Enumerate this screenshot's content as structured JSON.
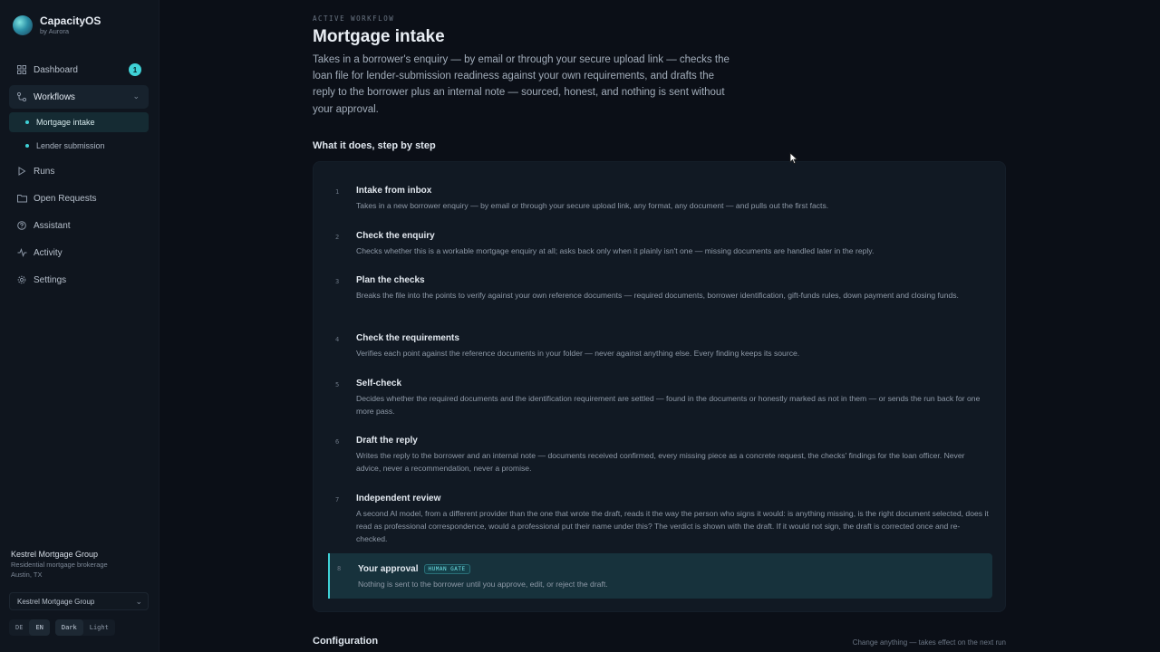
{
  "brand": {
    "name": "CapacityOS",
    "sub": "by Aurora"
  },
  "nav": {
    "dashboard": {
      "label": "Dashboard",
      "badge": "1"
    },
    "workflows": {
      "label": "Workflows"
    },
    "workflow_items": [
      "Mortgage intake",
      "Lender submission"
    ],
    "runs": "Runs",
    "open_requests": "Open Requests",
    "assistant": "Assistant",
    "activity": "Activity",
    "settings": "Settings"
  },
  "org": {
    "name": "Kestrel Mortgage Group",
    "type": "Residential mortgage brokerage",
    "location": "Austin, TX",
    "select_value": "Kestrel Mortgage Group"
  },
  "toggles": {
    "lang_de": "DE",
    "lang_en": "EN",
    "theme_dark": "Dark",
    "theme_light": "Light"
  },
  "main": {
    "eyebrow": "ACTIVE WORKFLOW",
    "title": "Mortgage intake",
    "description": "Takes in a borrower's enquiry — by email or through your secure upload link — checks the loan file for lender-submission readiness against your own requirements, and drafts the reply to the borrower plus an internal note — sourced, honest, and nothing is sent without your approval.",
    "steps_heading": "What it does, step by step",
    "steps": [
      {
        "num": "1",
        "title": "Intake from inbox",
        "body": "Takes in a new borrower enquiry — by email or through your secure upload link, any format, any document — and pulls out the first facts."
      },
      {
        "num": "2",
        "title": "Check the enquiry",
        "body": "Checks whether this is a workable mortgage enquiry at all; asks back only when it plainly isn't one — missing documents are handled later in the reply."
      },
      {
        "num": "3",
        "title": "Plan the checks",
        "body": "Breaks the file into the points to verify against your own reference documents — required documents, borrower identification, gift-funds rules, down payment and closing funds."
      },
      {
        "num": "4",
        "title": "Check the requirements",
        "body": "Verifies each point against the reference documents in your folder — never against anything else. Every finding keeps its source."
      },
      {
        "num": "5",
        "title": "Self-check",
        "body": "Decides whether the required documents and the identification requirement are settled — found in the documents or honestly marked as not in them — or sends the run back for one more pass."
      },
      {
        "num": "6",
        "title": "Draft the reply",
        "body": "Writes the reply to the borrower and an internal note — documents received confirmed, every missing piece as a concrete request, the checks' findings for the loan officer. Never advice, never a recommendation, never a promise."
      },
      {
        "num": "7",
        "title": "Independent review",
        "body": "A second AI model, from a different provider than the one that wrote the draft, reads it the way the person who signs it would: is anything missing, is the right document selected, does it read as professional correspondence, would a professional put their name under this? The verdict is shown with the draft. If it would not sign, the draft is corrected once and re-checked."
      },
      {
        "num": "8",
        "title": "Your approval",
        "tag": "HUMAN GATE",
        "body": "Nothing is sent to the borrower until you approve, edit, or reject the draft."
      }
    ],
    "config_heading": "Configuration",
    "config_note": "Change anything — takes effect on the next run"
  },
  "colors": {
    "accent": "#3fd1d6",
    "background": "#0b0f17",
    "sidebar": "#0f151e",
    "panel": "#111923"
  }
}
